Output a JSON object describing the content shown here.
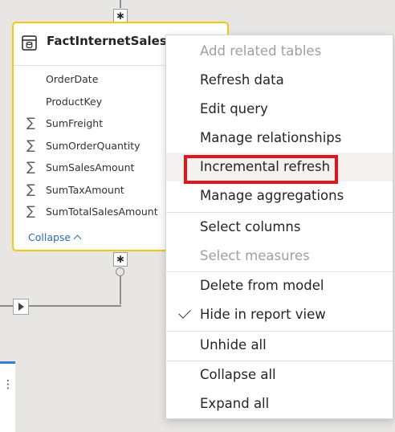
{
  "table_card": {
    "title": "FactInternetSales_agg",
    "fields": [
      {
        "name": "OrderDate",
        "icon": ""
      },
      {
        "name": "ProductKey",
        "icon": ""
      },
      {
        "name": "SumFreight",
        "icon": "∑"
      },
      {
        "name": "SumOrderQuantity",
        "icon": "∑"
      },
      {
        "name": "SumSalesAmount",
        "icon": "∑"
      },
      {
        "name": "SumTaxAmount",
        "icon": "∑"
      },
      {
        "name": "SumTotalSalesAmount",
        "icon": "∑"
      }
    ],
    "collapse_label": "Collapse",
    "header_icon": "table-icon"
  },
  "relationships": {
    "cardinality_symbol": "∗"
  },
  "second_card": {
    "menu_icon": "⋮"
  },
  "context_menu": {
    "items": [
      {
        "label": "Add related tables",
        "disabled": true
      },
      {
        "label": "Refresh data",
        "disabled": false
      },
      {
        "label": "Edit query",
        "disabled": false
      },
      {
        "label": "Manage relationships",
        "disabled": false
      },
      {
        "label": "Incremental refresh",
        "disabled": false,
        "highlighted": true
      },
      {
        "label": "Manage aggregations",
        "disabled": false
      },
      {
        "label": "Select columns",
        "disabled": false
      },
      {
        "label": "Select measures",
        "disabled": true
      },
      {
        "label": "Delete from model",
        "disabled": false
      },
      {
        "label": "Hide in report view",
        "disabled": false,
        "checked": true
      },
      {
        "label": "Unhide all",
        "disabled": false
      },
      {
        "label": "Collapse all",
        "disabled": false
      },
      {
        "label": "Expand all",
        "disabled": false
      }
    ]
  },
  "colors": {
    "card_border": "#f2c811",
    "highlight_box": "#e0161c",
    "link": "#2b6cb0",
    "canvas": "#e7e6e5"
  }
}
